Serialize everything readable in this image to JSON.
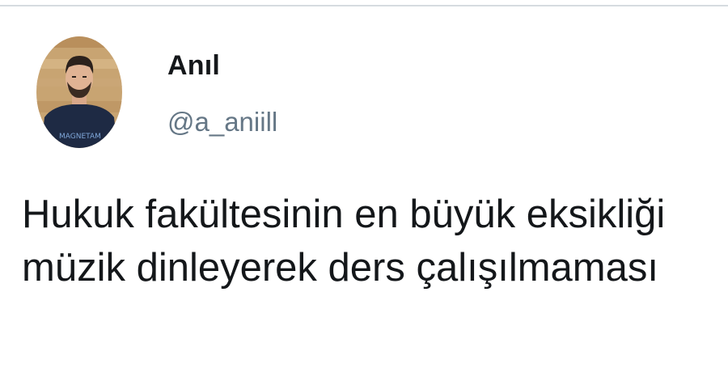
{
  "user": {
    "display_name": "Anıl",
    "handle": "@a_aniill",
    "avatar": "profile-photo"
  },
  "tweet": {
    "text": "Hukuk fakültesinin en büyük eksikliği müzik dinleyerek ders çalışılmaması"
  },
  "colors": {
    "text": "#14171a",
    "secondary": "#657786",
    "divider": "#d6dbe0"
  }
}
